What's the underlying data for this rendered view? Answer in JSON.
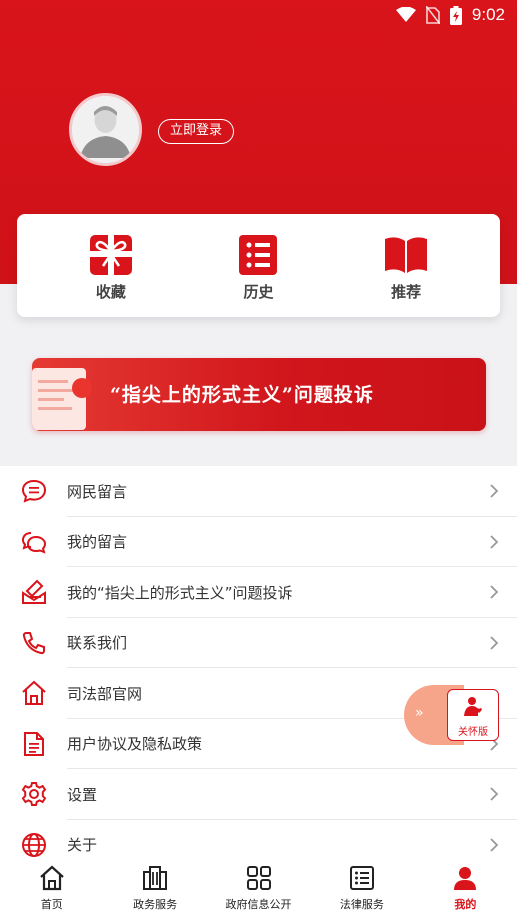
{
  "status_bar": {
    "time": "9:02"
  },
  "profile": {
    "login_label": "立即登录"
  },
  "quick_actions": [
    {
      "label": "收藏",
      "icon": "gift-icon"
    },
    {
      "label": "历史",
      "icon": "list-icon"
    },
    {
      "label": "推荐",
      "icon": "book-icon"
    }
  ],
  "banner": {
    "text": "“指尖上的形式主义”问题投诉"
  },
  "menu": [
    {
      "label": "网民留言",
      "icon": "chat-bubble-icon"
    },
    {
      "label": "我的留言",
      "icon": "chat-bubbles-icon"
    },
    {
      "label": "我的“指尖上的形式主义”问题投诉",
      "icon": "report-icon"
    },
    {
      "label": "联系我们",
      "icon": "phone-icon"
    },
    {
      "label": "司法部官网",
      "icon": "home-icon"
    },
    {
      "label": "用户协议及隐私政策",
      "icon": "document-icon"
    },
    {
      "label": "设置",
      "icon": "gear-icon"
    },
    {
      "label": "关于",
      "icon": "globe-icon"
    }
  ],
  "care_mode": {
    "label": "关怀版"
  },
  "tabbar": [
    {
      "label": "首页",
      "icon": "home-icon"
    },
    {
      "label": "政务服务",
      "icon": "building-icon"
    },
    {
      "label": "政府信息公开",
      "icon": "grid-icon"
    },
    {
      "label": "法律服务",
      "icon": "list-icon"
    },
    {
      "label": "我的",
      "icon": "user-icon",
      "active": true
    }
  ],
  "colors": {
    "primary": "#d9141b",
    "accent_orange": "#f6a58a"
  }
}
